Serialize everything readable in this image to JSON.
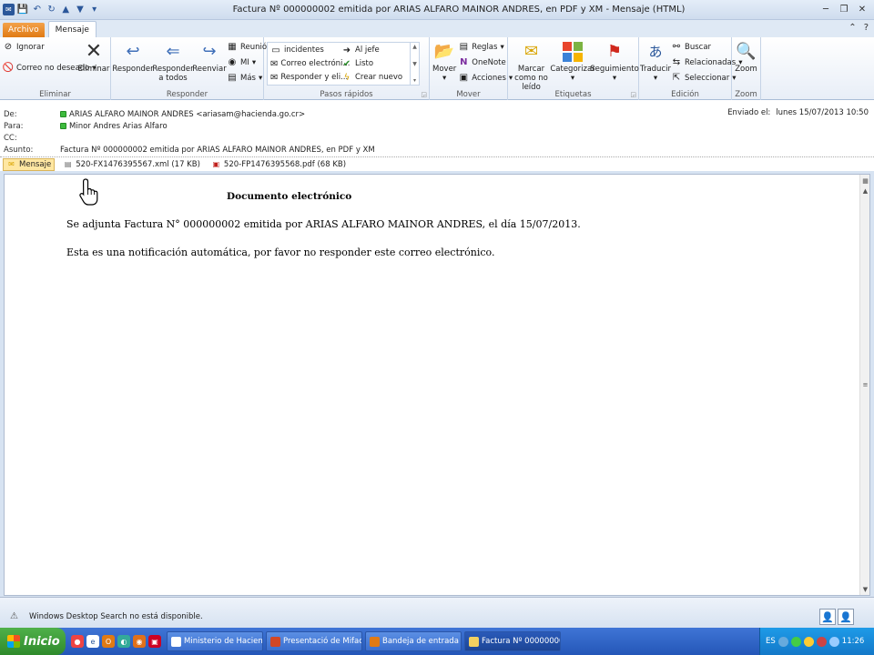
{
  "window": {
    "title": "Factura Nº 000000002 emitida por ARIAS ALFARO MAINOR ANDRES, en PDF y XM - Mensaje (HTML)"
  },
  "tabs": {
    "file": "Archivo",
    "message": "Mensaje"
  },
  "ribbon": {
    "eliminar": {
      "label": "Eliminar",
      "ignorar": "Ignorar",
      "correo_no_deseado": "Correo no deseado",
      "eliminar_btn": "Eliminar"
    },
    "responder": {
      "label": "Responder",
      "responder": "Responder",
      "responder_todos": "Responder a todos",
      "reenviar": "Reenviar",
      "reunion": "Reunión",
      "mi": "MI",
      "mas": "Más"
    },
    "pasos_rapidos": {
      "label": "Pasos rápidos",
      "items": [
        "incidentes",
        "Correo electróni...",
        "Responder y eli...",
        "Al jefe",
        "Listo",
        "Crear nuevo"
      ]
    },
    "mover": {
      "label": "Mover",
      "mover": "Mover",
      "reglas": "Reglas",
      "onenote": "OneNote",
      "acciones": "Acciones"
    },
    "etiquetas": {
      "label": "Etiquetas",
      "marcar": "Marcar como no leído",
      "categorizar": "Categorizar",
      "seguimiento": "Seguimiento"
    },
    "edicion": {
      "label": "Edición",
      "traducir": "Traducir",
      "buscar": "Buscar",
      "relacionadas": "Relacionadas",
      "seleccionar": "Seleccionar"
    },
    "zoom": {
      "label": "Zoom",
      "zoom": "Zoom"
    }
  },
  "header": {
    "de_label": "De:",
    "de_value": "ARIAS ALFARO MAINOR ANDRES <ariasam@hacienda.go.cr>",
    "para_label": "Para:",
    "para_value": "Minor Andres Arias Alfaro",
    "cc_label": "CC:",
    "asunto_label": "Asunto:",
    "asunto_value": "Factura Nº 000000002 emitida por ARIAS ALFARO MAINOR ANDRES, en PDF y XM",
    "enviado_label": "Enviado el:",
    "enviado_value": "lunes 15/07/2013 10:50"
  },
  "attachments": {
    "mensaje": "Mensaje",
    "xml": "520-FX1476395567.xml (17 KB)",
    "pdf": "520-FP1476395568.pdf (68 KB)"
  },
  "message": {
    "title": "Documento electrónico",
    "line1": "Se adjunta Factura N° 000000002 emitida por ARIAS ALFARO MAINOR ANDRES, el día 15/07/2013.",
    "line2": "Esta es una notificación automática, por favor no responder este correo electrónico."
  },
  "status": {
    "text": "Windows Desktop Search no está disponible."
  },
  "taskbar": {
    "start": "Inicio",
    "tasks": [
      "Ministerio de Hacienda...",
      "Presentació de Mifact...",
      "Bandeja de entrada -...",
      "Factura Nº 00000000..."
    ],
    "lang": "ES",
    "clock": "11:26"
  },
  "colors": {
    "accent": "#2b579a",
    "file_tab": "#e07a14",
    "taskbar": "#2456b8",
    "start": "#2f8a2b"
  }
}
